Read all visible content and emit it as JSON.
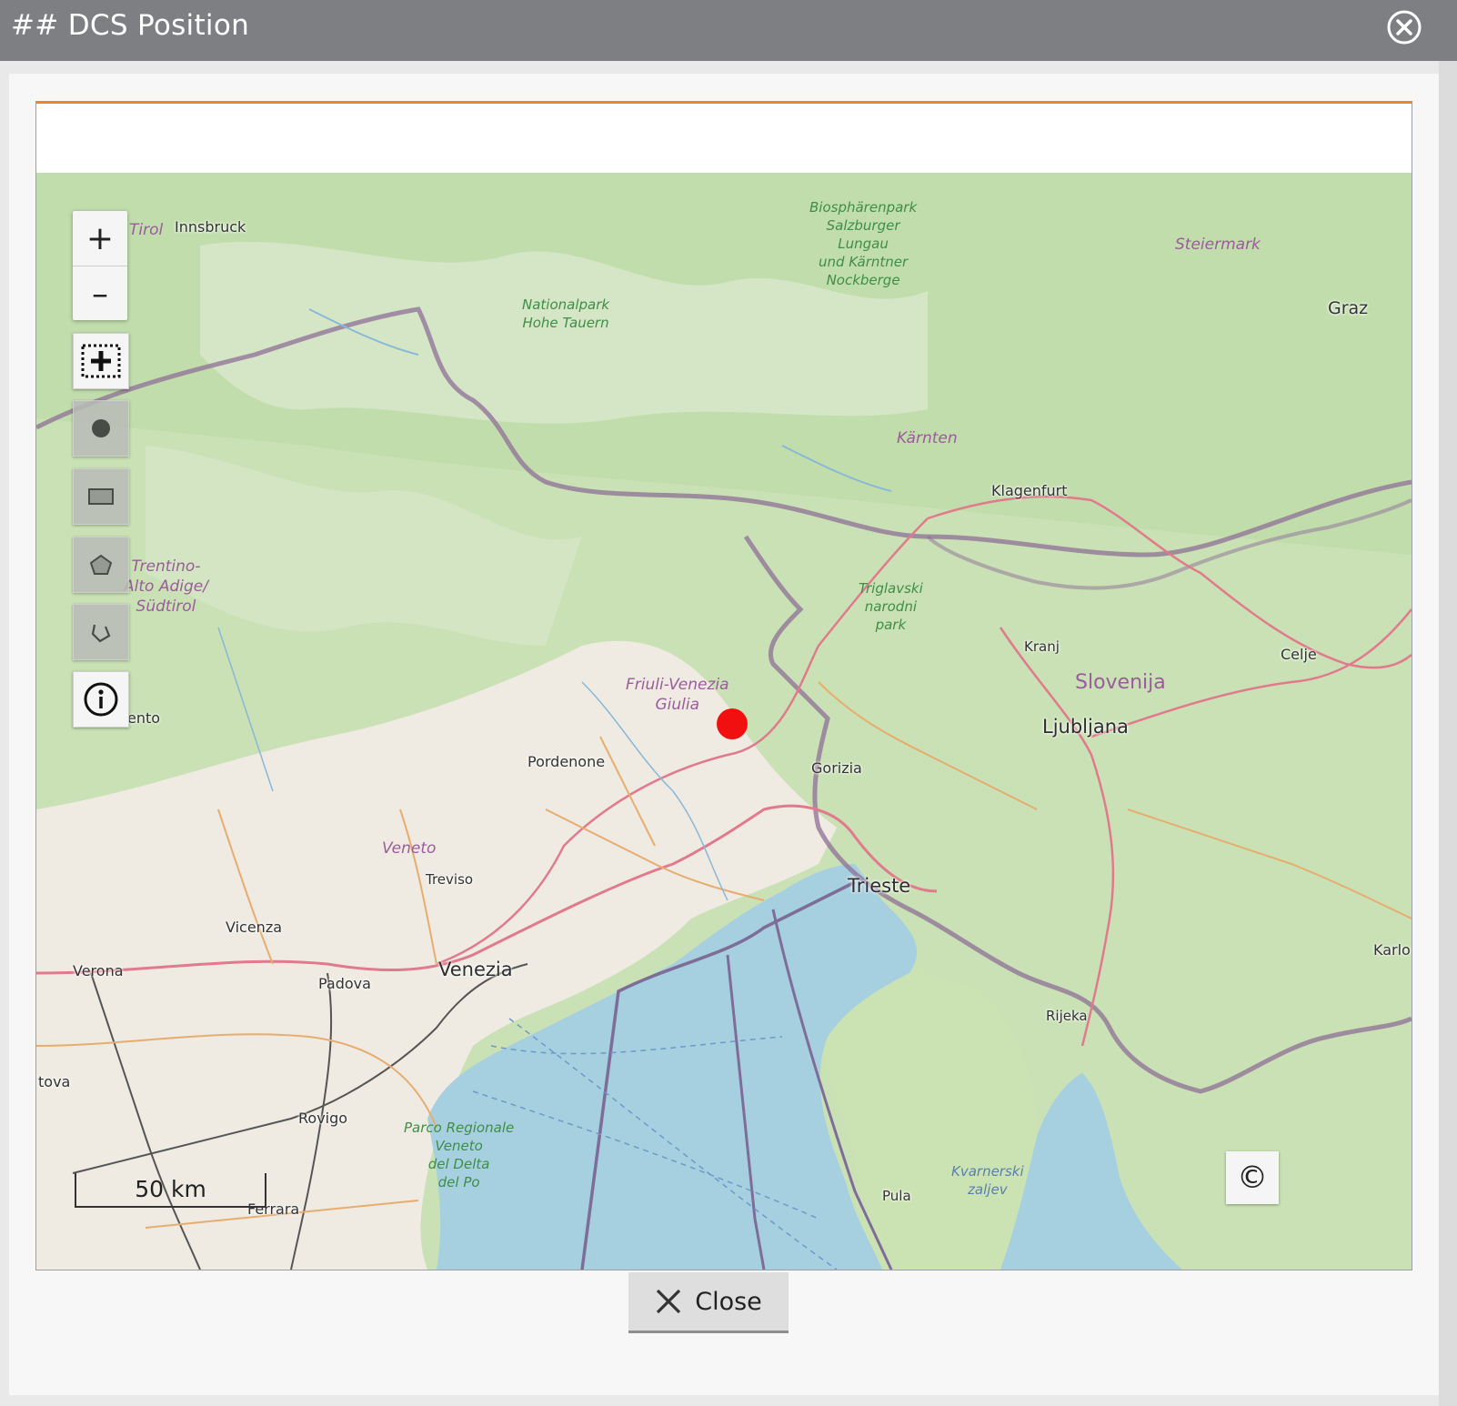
{
  "window": {
    "title": "## DCS Position"
  },
  "map": {
    "zoom_in_label": "+",
    "zoom_out_label": "–",
    "scale_label": "50 km",
    "attribution_label": "©",
    "marker_color": "#f20f0f",
    "tools": [
      "zoom-box-icon",
      "point-draw-icon",
      "rectangle-draw-icon",
      "polygon-draw-icon",
      "freehand-draw-icon",
      "info-icon"
    ],
    "labels": {
      "tirol": "Tirol",
      "innsbruck": "Innsbruck",
      "biosphere": [
        "Biosphärenpark",
        "Salzburger",
        "Lungau",
        "und Kärntner",
        "Nockberge"
      ],
      "steiermark": "Steiermark",
      "graz": "Graz",
      "nationalpark": [
        "Nationalpark",
        "Hohe Tauern"
      ],
      "karnten": "Kärnten",
      "klagenfurt": "Klagenfurt",
      "trentino": [
        "Trentino-",
        "Alto Adige/",
        "Südtirol"
      ],
      "triglav": [
        "Triglavski",
        "narodni",
        "park"
      ],
      "kranj": "Kranj",
      "celje": "Celje",
      "slovenija": "Slovenija",
      "ljubljana": "Ljubljana",
      "friuli": [
        "Friuli-Venezia",
        "Giulia"
      ],
      "pordenone": "Pordenone",
      "gorizia": "Gorizia",
      "ento": "ento",
      "veneto": "Veneto",
      "treviso": "Treviso",
      "trieste": "Trieste",
      "vicenza": "Vicenza",
      "verona": "Verona",
      "padova": "Padova",
      "venezia": "Venezia",
      "rijeka": "Rijeka",
      "karlo": "Karlo",
      "tova": "tova",
      "rovigo": "Rovigo",
      "parco": [
        "Parco Regionale",
        "Veneto",
        "del Delta",
        "del Po"
      ],
      "kvarnerski": [
        "Kvarnerski",
        "zaljev"
      ],
      "pula": "Pula",
      "ferrara": "Ferrara"
    }
  },
  "footer": {
    "close_label": "Close"
  }
}
